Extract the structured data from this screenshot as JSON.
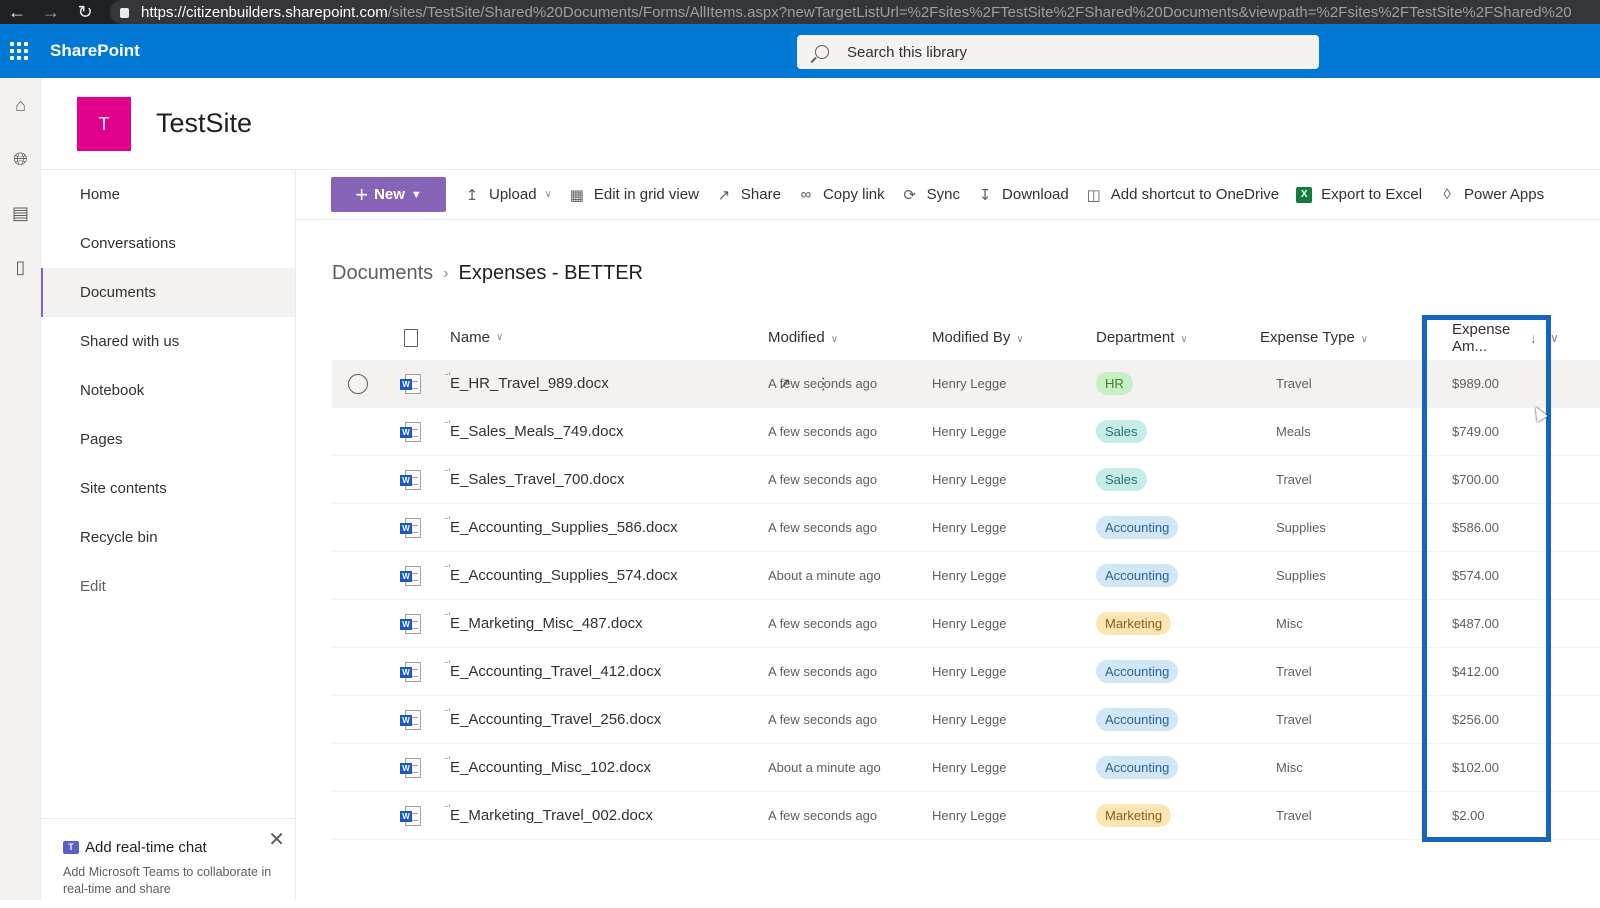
{
  "browser": {
    "url_host": "https://citizenbuilders.sharepoint.com",
    "url_rest": "/sites/TestSite/Shared%20Documents/Forms/AllItems.aspx?newTargetListUrl=%2Fsites%2FTestSite%2FShared%20Documents&viewpath=%2Fsites%2FTestSite%2FShared%20"
  },
  "suite": {
    "title": "SharePoint",
    "search_placeholder": "Search this library"
  },
  "site": {
    "logo_letter": "T",
    "title": "TestSite",
    "logo_color": "#e3008c"
  },
  "nav": {
    "items": [
      {
        "label": "Home"
      },
      {
        "label": "Conversations"
      },
      {
        "label": "Documents",
        "selected": true
      },
      {
        "label": "Shared with us"
      },
      {
        "label": "Notebook"
      },
      {
        "label": "Pages"
      },
      {
        "label": "Site contents"
      },
      {
        "label": "Recycle bin"
      },
      {
        "label": "Edit"
      }
    ]
  },
  "chat_card": {
    "title": "Add real-time chat",
    "description": "Add Microsoft Teams to collaborate in real-time and share"
  },
  "commands": {
    "new": "New",
    "upload": "Upload",
    "edit_grid": "Edit in grid view",
    "share": "Share",
    "copy_link": "Copy link",
    "sync": "Sync",
    "download": "Download",
    "add_shortcut": "Add shortcut to OneDrive",
    "export_excel": "Export to Excel",
    "power_apps": "Power Apps"
  },
  "breadcrumb": {
    "root": "Documents",
    "current": "Expenses - BETTER"
  },
  "table": {
    "columns": {
      "name": "Name",
      "modified": "Modified",
      "modified_by": "Modified By",
      "department": "Department",
      "expense_type": "Expense Type",
      "expense_amount": "Expense Am..."
    },
    "sort": {
      "column": "expense_amount",
      "direction": "descending"
    },
    "rows": [
      {
        "name": "E_HR_Travel_989.docx",
        "modified": "A few seconds ago",
        "modified_by": "Henry Legge",
        "department": "HR",
        "expense_type": "Travel",
        "amount": "$989.00"
      },
      {
        "name": "E_Sales_Meals_749.docx",
        "modified": "A few seconds ago",
        "modified_by": "Henry Legge",
        "department": "Sales",
        "expense_type": "Meals",
        "amount": "$749.00"
      },
      {
        "name": "E_Sales_Travel_700.docx",
        "modified": "A few seconds ago",
        "modified_by": "Henry Legge",
        "department": "Sales",
        "expense_type": "Travel",
        "amount": "$700.00"
      },
      {
        "name": "E_Accounting_Supplies_586.docx",
        "modified": "A few seconds ago",
        "modified_by": "Henry Legge",
        "department": "Accounting",
        "expense_type": "Supplies",
        "amount": "$586.00"
      },
      {
        "name": "E_Accounting_Supplies_574.docx",
        "modified": "About a minute ago",
        "modified_by": "Henry Legge",
        "department": "Accounting",
        "expense_type": "Supplies",
        "amount": "$574.00"
      },
      {
        "name": "E_Marketing_Misc_487.docx",
        "modified": "A few seconds ago",
        "modified_by": "Henry Legge",
        "department": "Marketing",
        "expense_type": "Misc",
        "amount": "$487.00"
      },
      {
        "name": "E_Accounting_Travel_412.docx",
        "modified": "A few seconds ago",
        "modified_by": "Henry Legge",
        "department": "Accounting",
        "expense_type": "Travel",
        "amount": "$412.00"
      },
      {
        "name": "E_Accounting_Travel_256.docx",
        "modified": "A few seconds ago",
        "modified_by": "Henry Legge",
        "department": "Accounting",
        "expense_type": "Travel",
        "amount": "$256.00"
      },
      {
        "name": "E_Accounting_Misc_102.docx",
        "modified": "About a minute ago",
        "modified_by": "Henry Legge",
        "department": "Accounting",
        "expense_type": "Misc",
        "amount": "$102.00"
      },
      {
        "name": "E_Marketing_Travel_002.docx",
        "modified": "A few seconds ago",
        "modified_by": "Henry Legge",
        "department": "Marketing",
        "expense_type": "Travel",
        "amount": "$2.00"
      }
    ]
  },
  "department_colors": {
    "HR": {
      "bg": "#c8efc3",
      "fg": "#437a3a"
    },
    "Sales": {
      "bg": "#c6ece8",
      "fg": "#2e7069"
    },
    "Accounting": {
      "bg": "#d1e6f6",
      "fg": "#2b6496"
    },
    "Marketing": {
      "bg": "#fbe5b3",
      "fg": "#8a5a12"
    }
  },
  "accent": {
    "suite_blue": "#0078d4",
    "new_button": "#8764b8",
    "highlight": "#1565c0"
  }
}
